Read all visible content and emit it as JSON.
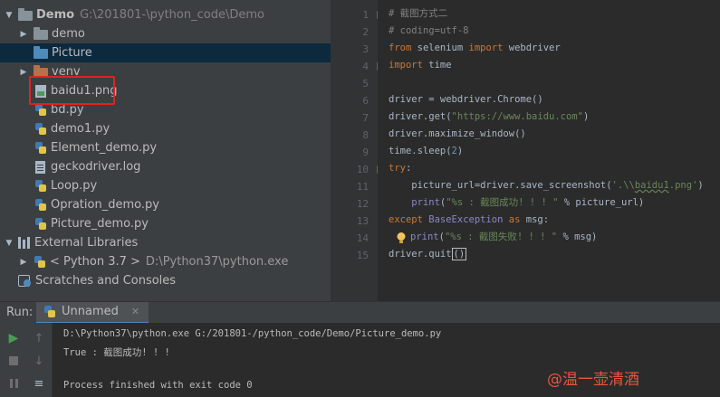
{
  "project": {
    "root_name": "Demo",
    "root_path": "G:\\201801-\\python_code\\Demo",
    "items": [
      {
        "label": "demo",
        "kind": "folder"
      },
      {
        "label": "Picture",
        "kind": "folder"
      },
      {
        "label": "venv",
        "kind": "folder"
      },
      {
        "label": "baidu1.png",
        "kind": "image"
      },
      {
        "label": "bd.py",
        "kind": "python"
      },
      {
        "label": "demo1.py",
        "kind": "python"
      },
      {
        "label": "Element_demo.py",
        "kind": "python"
      },
      {
        "label": "geckodriver.log",
        "kind": "text"
      },
      {
        "label": "Loop.py",
        "kind": "python"
      },
      {
        "label": "Opration_demo.py",
        "kind": "python"
      },
      {
        "label": "Picture_demo.py",
        "kind": "python"
      }
    ],
    "external_libraries": "External Libraries",
    "python_sdk": "< Python 3.7 >",
    "python_sdk_path": "D:\\Python37\\python.exe",
    "scratches": "Scratches and Consoles"
  },
  "editor": {
    "line_numbers": [
      "1",
      "2",
      "3",
      "4",
      "5",
      "6",
      "7",
      "8",
      "9",
      "10",
      "11",
      "12",
      "13",
      "14",
      "15"
    ],
    "lines": {
      "l1": "# 截图方式二",
      "l2": "# coding=utf-8",
      "l3_kw1": "from",
      "l3_mid": " selenium ",
      "l3_kw2": "import",
      "l3_end": " webdriver",
      "l4_kw": "import",
      "l4_end": " time",
      "l6": "driver = webdriver.Chrome()",
      "l7_start": "driver.get(",
      "l7_str": "\"https://www.baidu.com\"",
      "l7_end": ")",
      "l8": "driver.maximize_window()",
      "l9_start": "time.sleep(",
      "l9_num": "2",
      "l9_end": ")",
      "l10_kw": "try",
      "l10_end": ":",
      "l11_start": "    picture_url=driver.save_screenshot(",
      "l11_str1": "'.\\\\",
      "l11_str2": "baidu1",
      "l11_str3": ".png'",
      "l11_end": ")",
      "l12_kw": "    print",
      "l12_start": "(",
      "l12_str": "\"%s : 截图成功! ! ! \"",
      "l12_end": " % picture_url)",
      "l13_kw1": "except",
      "l13_mid": " BaseException ",
      "l13_kw2": "as",
      "l13_end": " msg:",
      "l14_kw": "print",
      "l14_start": "(",
      "l14_str": "\"%s : 截图失败! ! ! \"",
      "l14_end": " % msg)",
      "l15_start": "driver.quit",
      "l15_paren": "()"
    }
  },
  "run": {
    "label": "Run:",
    "tab_label": "Unnamed",
    "console": [
      "D:\\Python37\\python.exe G:/201801-/python_code/Demo/Picture_demo.py",
      "True : 截图成功! ! !",
      "",
      "Process finished with exit code 0"
    ]
  },
  "watermark": "@温一壶清酒",
  "colors": {
    "highlight_box": "#e0231e",
    "keyword": "#cc7832",
    "string": "#6a8759",
    "comment": "#808080",
    "number": "#6897bb",
    "run_green": "#499c54"
  }
}
